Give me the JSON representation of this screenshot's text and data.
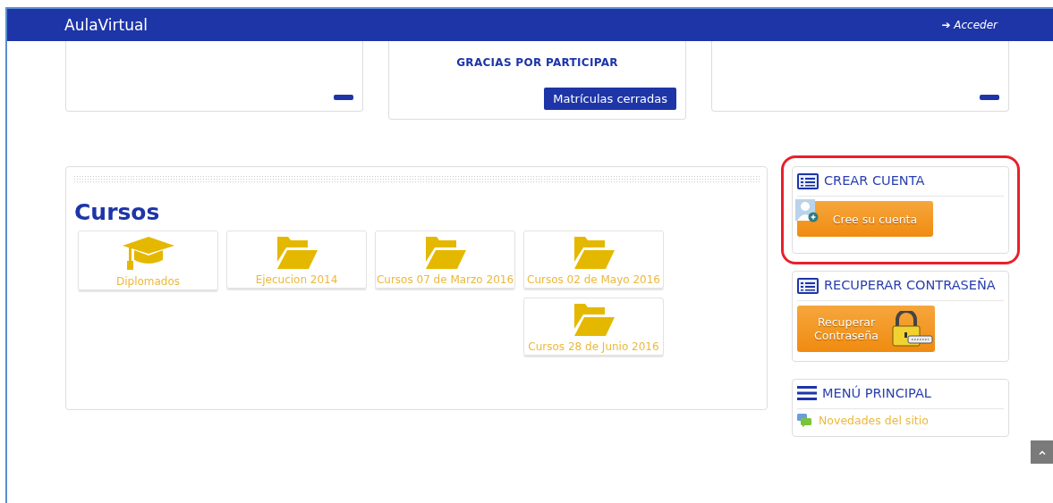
{
  "header": {
    "brand": "AulaVirtual",
    "login_icon": "➔",
    "login": "Acceder"
  },
  "top_cards": [
    {
      "kind": "plain"
    },
    {
      "kind": "notice",
      "text": "GRACIAS POR PARTICIPAR",
      "button": "Matrículas cerradas"
    },
    {
      "kind": "plain"
    }
  ],
  "courses": {
    "title": "Cursos",
    "items": [
      {
        "kind": "cap",
        "label": "Diplomados"
      },
      {
        "kind": "folder",
        "label": "Ejecucion 2014"
      },
      {
        "kind": "folder",
        "label": "Cursos 07 de Marzo 2016"
      },
      {
        "kind": "folder",
        "label": "Cursos 02 de Mayo 2016"
      },
      {
        "kind": "folder",
        "label": "Cursos 28 de Junio 2016"
      }
    ]
  },
  "blocks": [
    {
      "kind": "signup",
      "title": "CREAR CUENTA",
      "highlighted": true,
      "button": "Cree su cuenta"
    },
    {
      "kind": "password",
      "title": "RECUPERAR CONTRASEÑA",
      "highlighted": false,
      "button": "Recuperar Contraseña"
    },
    {
      "kind": "menu",
      "title": "MENÚ PRINCIPAL",
      "highlighted": false,
      "links": [
        "Novedades del sitio"
      ]
    }
  ]
}
